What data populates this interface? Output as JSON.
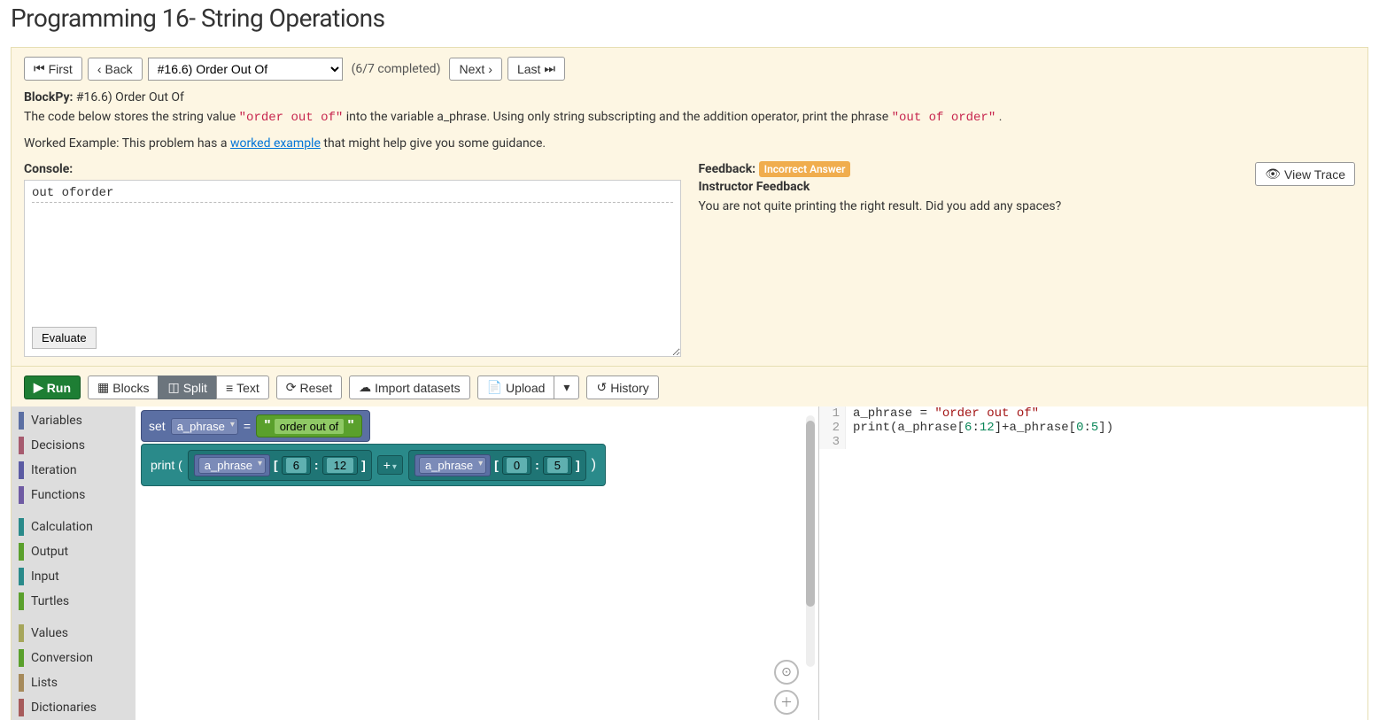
{
  "page_title": "Programming 16- String Operations",
  "nav": {
    "first": "First",
    "back": "Back",
    "next": "Next",
    "last": "Last",
    "select_value": "#16.6) Order Out Of",
    "completed": "(6/7 completed)"
  },
  "problem": {
    "label": "BlockPy:",
    "id": "#16.6) Order Out Of",
    "desc_pre": "The code below stores the string value ",
    "literal1": "\"order out of\"",
    "desc_mid": " into the variable a_phrase. Using only string subscripting and the addition operator, print the phrase ",
    "literal2": "\"out of order\"",
    "desc_post": ".",
    "worked_pre": "Worked Example: This problem has a ",
    "worked_link": "worked example",
    "worked_post": " that might help give you some guidance."
  },
  "console": {
    "label": "Console:",
    "output": "out oforder",
    "evaluate": "Evaluate"
  },
  "feedback": {
    "label": "Feedback:",
    "badge": "Incorrect Answer",
    "subhead": "Instructor Feedback",
    "body": "You are not quite printing the right result. Did you add any spaces?",
    "view_trace": "View Trace"
  },
  "toolbar": {
    "run": "Run",
    "blocks": "Blocks",
    "split": "Split",
    "text": "Text",
    "reset": "Reset",
    "import": "Import datasets",
    "upload": "Upload",
    "history": "History"
  },
  "categories": {
    "g1": [
      "Variables",
      "Decisions",
      "Iteration",
      "Functions"
    ],
    "g2": [
      "Calculation",
      "Output",
      "Input",
      "Turtles"
    ],
    "g3": [
      "Values",
      "Conversion",
      "Lists",
      "Dictionaries"
    ]
  },
  "cat_colors": {
    "Variables": "#5b6fa3",
    "Decisions": "#a65b6f",
    "Iteration": "#5b5ba3",
    "Functions": "#6f5ba3",
    "Calculation": "#2a8a8a",
    "Output": "#5aa02c",
    "Input": "#2a8a8a",
    "Turtles": "#5aa02c",
    "Values": "#a6a65b",
    "Conversion": "#5aa02c",
    "Lists": "#a68a5b",
    "Dictionaries": "#a65b5b"
  },
  "blocks": {
    "set_label": "set",
    "var_name": "a_phrase",
    "eq": "=",
    "string_value": "order out of",
    "print_label": "print (",
    "close_paren": ")",
    "lbr": "[",
    "rbr": "]",
    "colon": ":",
    "plus": "+",
    "idx1a": "6",
    "idx1b": "12",
    "idx2a": "0",
    "idx2b": "5"
  },
  "code": {
    "l1": "a_phrase = ",
    "l1s": "\"order out of\"",
    "l2a": "print(a_phrase[",
    "l2n1": "6",
    "l2b": ":",
    "l2n2": "12",
    "l2c": "]+a_phrase[",
    "l2n3": "0",
    "l2d": ":",
    "l2n4": "5",
    "l2e": "])"
  }
}
